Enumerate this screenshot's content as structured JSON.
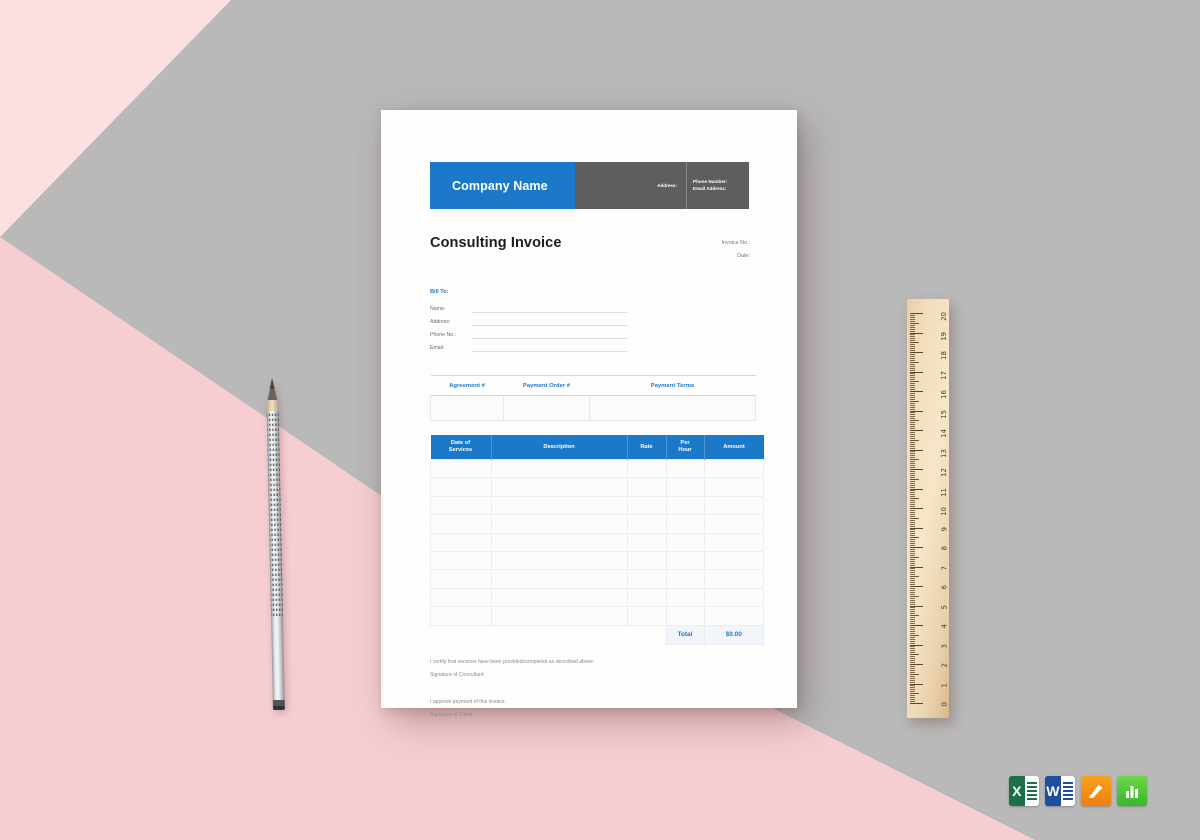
{
  "scene": {
    "background_colors": {
      "gray": "#b9b9b9",
      "pink_light": "#fde0e1",
      "pink_deep": "#f6ced1"
    }
  },
  "invoice": {
    "header": {
      "company_name": "Company Name",
      "address_label": "Address:",
      "phone_label": "Phone Number:",
      "email_label": "Email Address:",
      "brand_color": "#1c79c9",
      "bar_color": "#5e5e5e"
    },
    "title": "Consulting Invoice",
    "meta": {
      "invoice_no_label": "Invoice No.:",
      "date_label": "Date:"
    },
    "bill_to": {
      "heading": "Bill To:",
      "fields": [
        {
          "label": "Name:",
          "value": ""
        },
        {
          "label": "Address:",
          "value": ""
        },
        {
          "label": "Phone No.:",
          "value": ""
        },
        {
          "label": "Email:",
          "value": ""
        }
      ]
    },
    "agreement_table": {
      "headers": [
        "Agreement #",
        "Payment Order #",
        "Payment Terms"
      ],
      "rows": [
        [
          "",
          "",
          ""
        ]
      ]
    },
    "services_table": {
      "headers": [
        {
          "line1": "Date of",
          "line2": "Services"
        },
        {
          "line1": "Description",
          "line2": ""
        },
        {
          "line1": "Rate",
          "line2": ""
        },
        {
          "line1": "Per",
          "line2": "Hour"
        },
        {
          "line1": "Amount",
          "line2": ""
        }
      ],
      "row_count": 9,
      "rows": [],
      "total_label": "Total",
      "total_value": "$0.00"
    },
    "footer": {
      "certify_text": "I certify that services have been provided/completed as described above.",
      "consultant_signature_label": "Signature of Consultant:",
      "approve_text": "I approve payment of this invoice:",
      "client_signature_label": "Signature of Client:"
    }
  },
  "props": {
    "pencil": {
      "name": "pencil",
      "color": "#b9b9b9"
    },
    "ruler": {
      "name": "wooden-ruler",
      "unit_numbers": [
        "20",
        "19",
        "18",
        "17",
        "16",
        "15",
        "14",
        "13",
        "12",
        "11",
        "10",
        "9",
        "8",
        "7",
        "6",
        "5",
        "4",
        "3",
        "2",
        "1",
        "0"
      ]
    }
  },
  "app_icons": [
    {
      "name": "excel-icon",
      "letter": "X",
      "color": "#1d7044",
      "label": "Excel"
    },
    {
      "name": "word-icon",
      "letter": "W",
      "color": "#1f4f9c",
      "label": "Word"
    },
    {
      "name": "pages-icon",
      "letter": "",
      "color": "#ef7f12",
      "label": "Pages"
    },
    {
      "name": "numbers-icon",
      "letter": "",
      "color": "#36b92a",
      "label": "Numbers"
    }
  ]
}
